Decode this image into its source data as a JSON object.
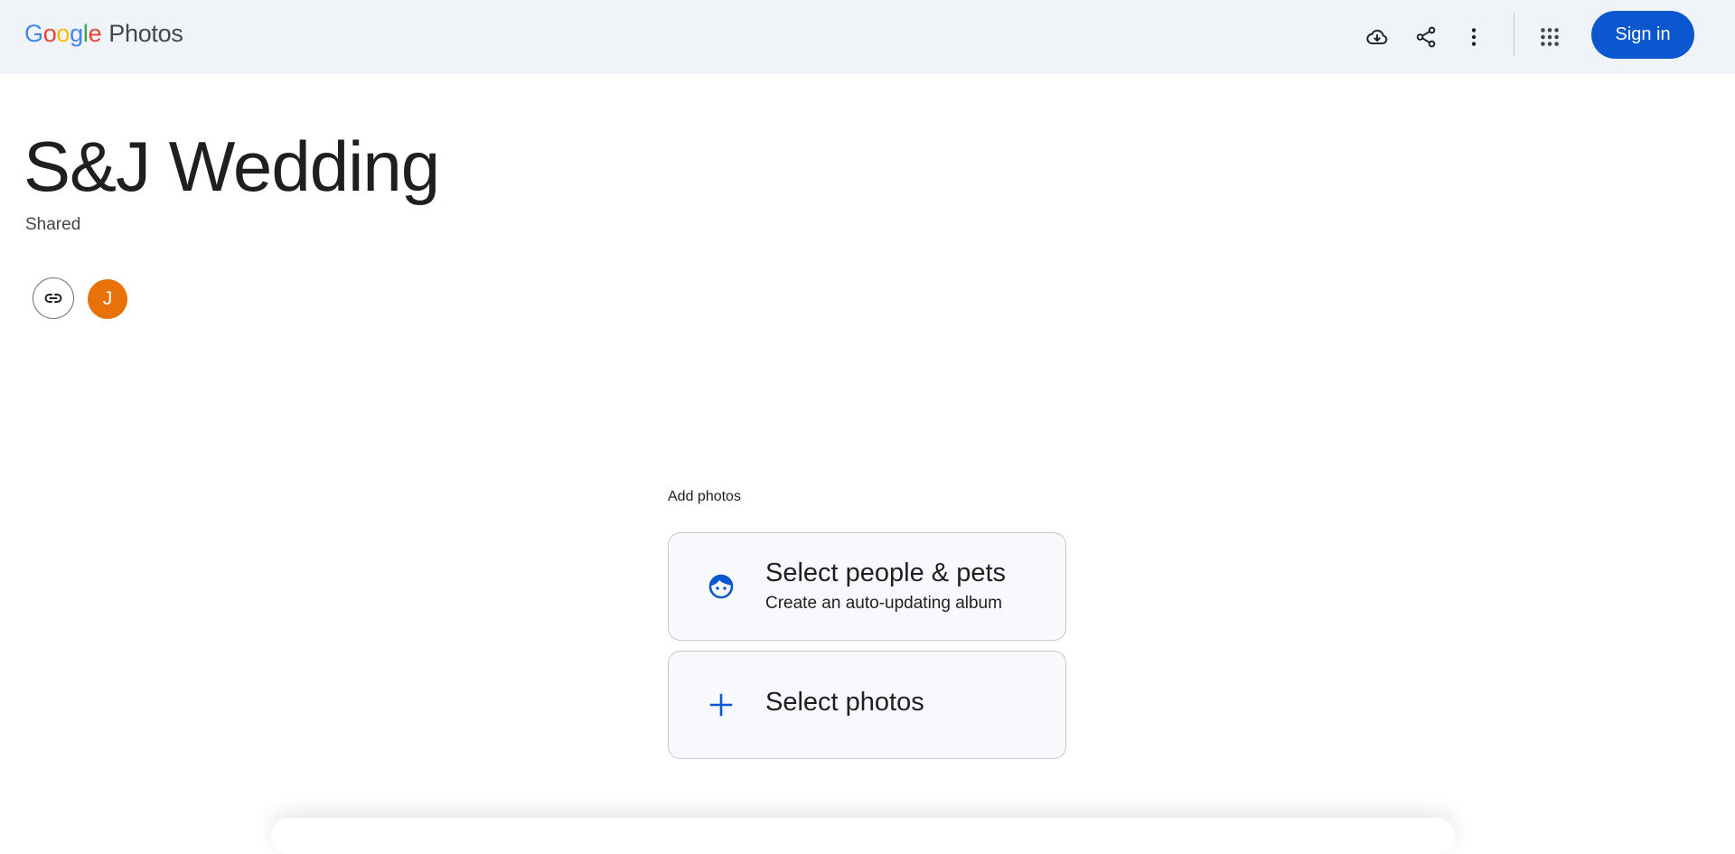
{
  "app": {
    "logo_letters": [
      {
        "char": "G",
        "color": "#4285f4"
      },
      {
        "char": "o",
        "color": "#ea4335"
      },
      {
        "char": "o",
        "color": "#fbbc04"
      },
      {
        "char": "g",
        "color": "#4285f4"
      },
      {
        "char": "l",
        "color": "#34a853"
      },
      {
        "char": "e",
        "color": "#ea4335"
      }
    ],
    "product_name": "Photos"
  },
  "header": {
    "icons": [
      "cloud-download-icon",
      "share-icon",
      "more-vertical-icon",
      "apps-grid-icon"
    ],
    "sign_in_label": "Sign in",
    "accent_color": "#0b57d0",
    "background_color": "#f0f4f9"
  },
  "album": {
    "title": "S&J Wedding",
    "status": "Shared",
    "avatar_initial": "J",
    "avatar_color": "#e8710a",
    "link_icon": "link-icon"
  },
  "add_photos": {
    "label": "Add photos",
    "options": [
      {
        "icon": "face-icon",
        "title": "Select people & pets",
        "subtitle": "Create an auto-updating album"
      },
      {
        "icon": "plus-icon",
        "title": "Select photos"
      }
    ]
  }
}
